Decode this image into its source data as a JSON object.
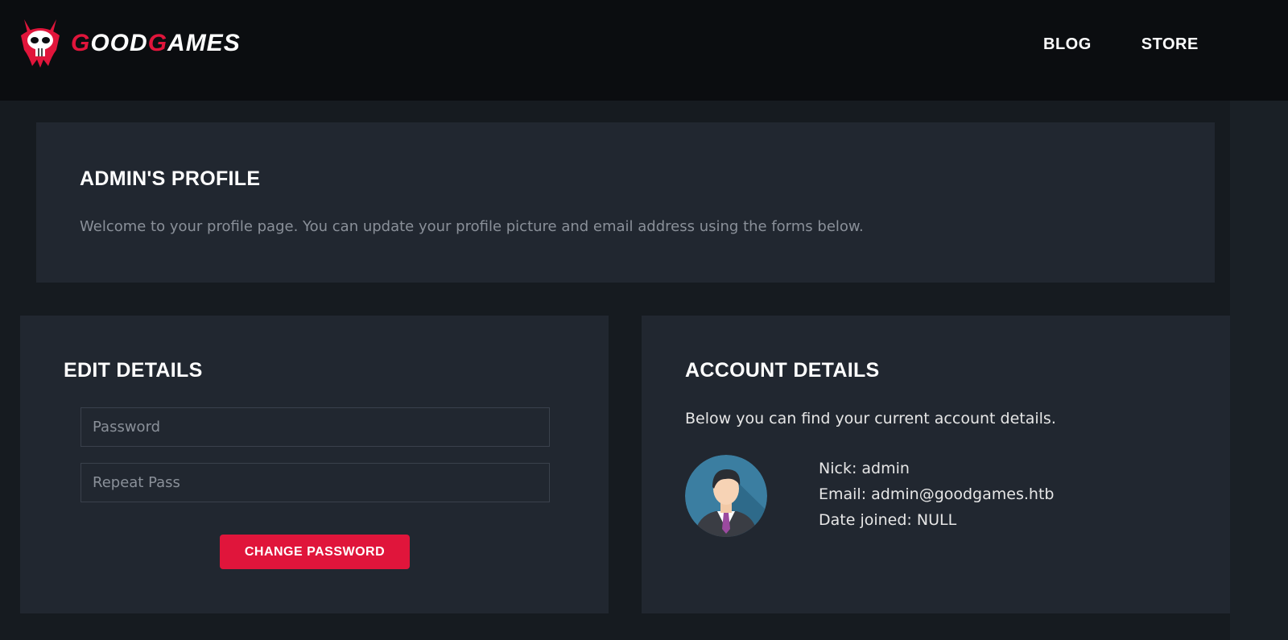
{
  "brand": {
    "name_part1_initial": "G",
    "name_part1_rest": "OOD",
    "name_part2_initial": "G",
    "name_part2_rest": "AMES"
  },
  "nav": {
    "blog": "BLOG",
    "store": "STORE"
  },
  "profile": {
    "title": "ADMIN'S PROFILE",
    "description": "Welcome to your profile page. You can update your profile picture and email address using the forms below."
  },
  "edit": {
    "title": "EDIT DETAILS",
    "password_placeholder": "Password",
    "repeat_placeholder": "Repeat Pass",
    "button": "CHANGE PASSWORD"
  },
  "account": {
    "title": "ACCOUNT DETAILS",
    "intro": "Below you can find your current account details.",
    "nick": "Nick: admin",
    "email": "Email: admin@goodgames.htb",
    "date_joined": "Date joined: NULL"
  },
  "colors": {
    "accent": "#e0153b",
    "panel": "#212730",
    "background": "#161b20",
    "header": "#0b0d10"
  },
  "icons": {
    "logo": "skull-logo-icon",
    "avatar": "user-avatar-icon"
  }
}
